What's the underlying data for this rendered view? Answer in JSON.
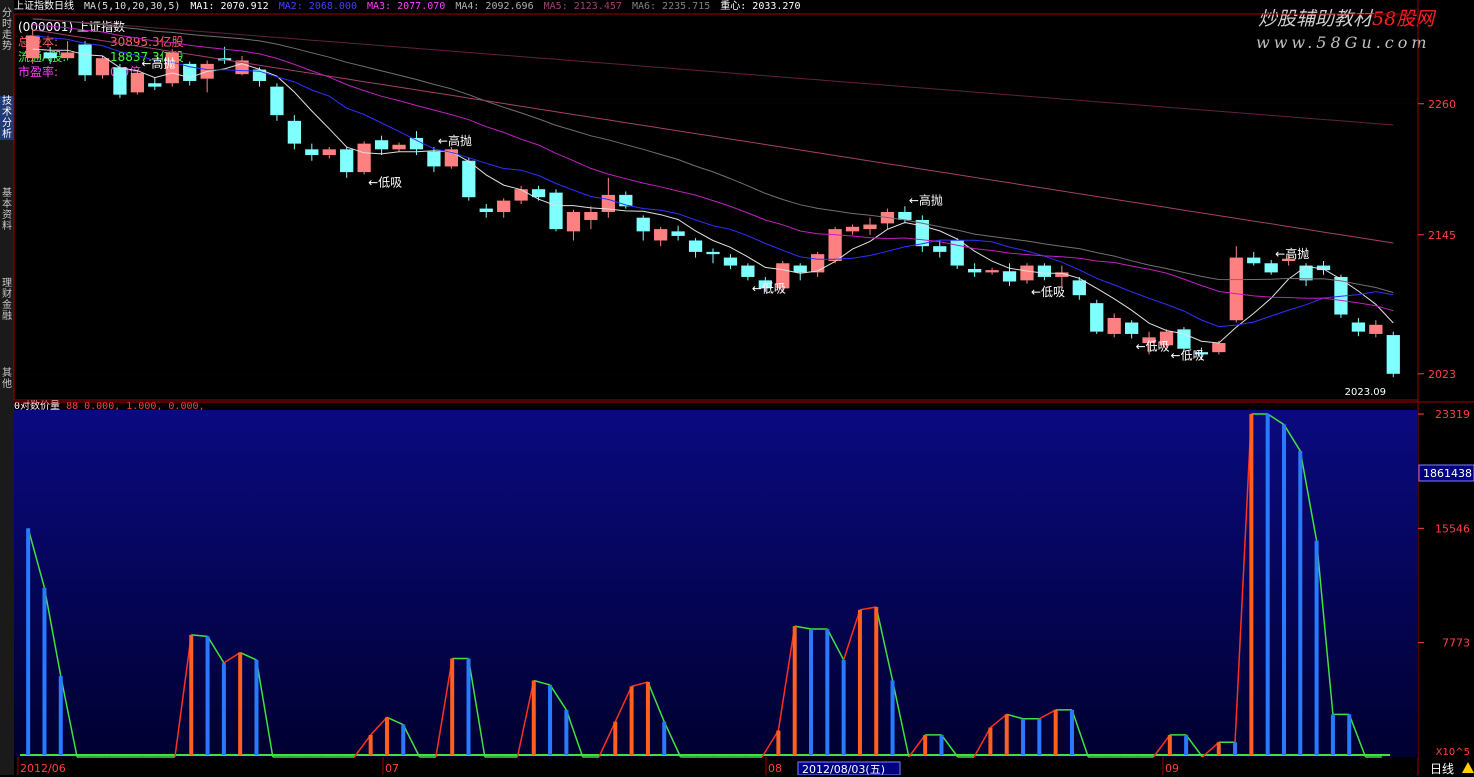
{
  "sidebar": {
    "tabs": [
      {
        "label": "分时走势",
        "active": false
      },
      {
        "label": "技术分析",
        "active": true
      },
      {
        "label": "基本资料",
        "active": false
      },
      {
        "label": "理财金融",
        "active": false
      },
      {
        "label": "其他",
        "active": false
      }
    ]
  },
  "header": {
    "title": "上证指数日线",
    "ma_params": "MA(5,10,20,30,5)",
    "ma1": "MA1: 2070.912",
    "ma2": "MA2: 2068.000",
    "ma3": "MA3: 2077.070",
    "ma4": "MA4: 2092.696",
    "ma5": "MA5: 2123.457",
    "ma6": "MA6: 2235.715",
    "center": "重心: 2033.270"
  },
  "stock_info": {
    "code_name": "(000001) 上证指数",
    "total_shares_label": "总股本:",
    "total_shares_value": "30895.3亿股",
    "float_shares_label": "流通A股:",
    "float_shares_value": "18837.3亿股",
    "pe_label": "市盈率:",
    "pe_value": "0.0倍"
  },
  "watermark": {
    "line1": "炒股辅助教材",
    "line1_red": "58股网",
    "line2": "www.58Gu.com"
  },
  "price_axis": {
    "labels": [
      "2260",
      "2145",
      "2023"
    ],
    "current": "2023.09"
  },
  "indicator": {
    "title": "0对数价量",
    "params": "88 0.000, 1.000, 0.000,",
    "axis_labels": [
      "23319",
      "15546",
      "7773",
      "X10^5"
    ],
    "current": "1861438"
  },
  "time_axis": {
    "labels": [
      "2012/06",
      "07",
      "08",
      "09"
    ],
    "cursor": "2012/08/03(五)"
  },
  "signals": {
    "high": "←高抛",
    "low": "←低吸"
  },
  "status": {
    "period": "日线"
  },
  "colors": {
    "up": "#ff8080",
    "down": "#80ffff",
    "ma_white": "#e0e0e0",
    "ma_blue": "#3030ff",
    "ma_magenta": "#c020c0",
    "ma_pink": "#a04070",
    "ind_bg_top": "#0a0a80",
    "ind_bg_bottom": "#000030",
    "bar_blue": "#2a7aff",
    "bar_orange": "#ff6020",
    "line_green": "#40e040"
  },
  "chart_data": [
    {
      "type": "candlestick",
      "title": "上证指数日线",
      "ylim": [
        2000,
        2330
      ],
      "candles": [
        {
          "o": 2300,
          "c": 2320,
          "h": 2325,
          "l": 2295
        },
        {
          "o": 2305,
          "c": 2300,
          "h": 2310,
          "l": 2295
        },
        {
          "o": 2300,
          "c": 2305,
          "h": 2315,
          "l": 2298
        },
        {
          "o": 2312,
          "c": 2285,
          "h": 2315,
          "l": 2280
        },
        {
          "o": 2285,
          "c": 2300,
          "h": 2302,
          "l": 2282
        },
        {
          "o": 2292,
          "c": 2268,
          "h": 2295,
          "l": 2265
        },
        {
          "o": 2270,
          "c": 2287,
          "h": 2290,
          "l": 2268
        },
        {
          "o": 2278,
          "c": 2275,
          "h": 2283,
          "l": 2272
        },
        {
          "o": 2278,
          "c": 2305,
          "h": 2308,
          "l": 2275
        },
        {
          "o": 2295,
          "c": 2280,
          "h": 2297,
          "l": 2276
        },
        {
          "o": 2282,
          "c": 2295,
          "h": 2298,
          "l": 2270
        },
        {
          "o": 2300,
          "c": 2298,
          "h": 2310,
          "l": 2295
        },
        {
          "o": 2286,
          "c": 2298,
          "h": 2302,
          "l": 2285
        },
        {
          "o": 2290,
          "c": 2280,
          "h": 2292,
          "l": 2275
        },
        {
          "o": 2275,
          "c": 2250,
          "h": 2278,
          "l": 2245
        },
        {
          "o": 2245,
          "c": 2225,
          "h": 2250,
          "l": 2220
        },
        {
          "o": 2220,
          "c": 2215,
          "h": 2225,
          "l": 2210
        },
        {
          "o": 2215,
          "c": 2220,
          "h": 2222,
          "l": 2212
        },
        {
          "o": 2220,
          "c": 2200,
          "h": 2222,
          "l": 2195
        },
        {
          "o": 2200,
          "c": 2225,
          "h": 2227,
          "l": 2198
        },
        {
          "o": 2228,
          "c": 2220,
          "h": 2232,
          "l": 2215
        },
        {
          "o": 2220,
          "c": 2224,
          "h": 2226,
          "l": 2218
        },
        {
          "o": 2230,
          "c": 2220,
          "h": 2236,
          "l": 2215
        },
        {
          "o": 2218,
          "c": 2205,
          "h": 2222,
          "l": 2200
        },
        {
          "o": 2205,
          "c": 2220,
          "h": 2222,
          "l": 2203
        },
        {
          "o": 2210,
          "c": 2178,
          "h": 2213,
          "l": 2175
        },
        {
          "o": 2168,
          "c": 2165,
          "h": 2172,
          "l": 2160
        },
        {
          "o": 2165,
          "c": 2175,
          "h": 2177,
          "l": 2160
        },
        {
          "o": 2175,
          "c": 2185,
          "h": 2188,
          "l": 2172
        },
        {
          "o": 2185,
          "c": 2178,
          "h": 2188,
          "l": 2175
        },
        {
          "o": 2182,
          "c": 2150,
          "h": 2185,
          "l": 2148
        },
        {
          "o": 2148,
          "c": 2165,
          "h": 2167,
          "l": 2140
        },
        {
          "o": 2158,
          "c": 2165,
          "h": 2170,
          "l": 2150
        },
        {
          "o": 2165,
          "c": 2180,
          "h": 2195,
          "l": 2160
        },
        {
          "o": 2180,
          "c": 2170,
          "h": 2183,
          "l": 2168
        },
        {
          "o": 2160,
          "c": 2148,
          "h": 2162,
          "l": 2140
        },
        {
          "o": 2140,
          "c": 2150,
          "h": 2152,
          "l": 2135
        },
        {
          "o": 2148,
          "c": 2144,
          "h": 2153,
          "l": 2140
        },
        {
          "o": 2140,
          "c": 2130,
          "h": 2142,
          "l": 2125
        },
        {
          "o": 2130,
          "c": 2128,
          "h": 2133,
          "l": 2120
        },
        {
          "o": 2125,
          "c": 2118,
          "h": 2128,
          "l": 2115
        },
        {
          "o": 2118,
          "c": 2108,
          "h": 2120,
          "l": 2105
        },
        {
          "o": 2105,
          "c": 2098,
          "h": 2108,
          "l": 2095
        },
        {
          "o": 2098,
          "c": 2120,
          "h": 2122,
          "l": 2095
        },
        {
          "o": 2118,
          "c": 2112,
          "h": 2120,
          "l": 2105
        },
        {
          "o": 2112,
          "c": 2128,
          "h": 2130,
          "l": 2108
        },
        {
          "o": 2122,
          "c": 2150,
          "h": 2152,
          "l": 2120
        },
        {
          "o": 2148,
          "c": 2152,
          "h": 2154,
          "l": 2145
        },
        {
          "o": 2150,
          "c": 2154,
          "h": 2160,
          "l": 2145
        },
        {
          "o": 2155,
          "c": 2165,
          "h": 2168,
          "l": 2150
        },
        {
          "o": 2165,
          "c": 2158,
          "h": 2170,
          "l": 2155
        },
        {
          "o": 2158,
          "c": 2135,
          "h": 2162,
          "l": 2130
        },
        {
          "o": 2135,
          "c": 2130,
          "h": 2140,
          "l": 2125
        },
        {
          "o": 2140,
          "c": 2118,
          "h": 2142,
          "l": 2115
        },
        {
          "o": 2115,
          "c": 2112,
          "h": 2120,
          "l": 2108
        },
        {
          "o": 2112,
          "c": 2114,
          "h": 2116,
          "l": 2110
        },
        {
          "o": 2113,
          "c": 2104,
          "h": 2120,
          "l": 2100
        },
        {
          "o": 2105,
          "c": 2118,
          "h": 2120,
          "l": 2102
        },
        {
          "o": 2118,
          "c": 2108,
          "h": 2120,
          "l": 2105
        },
        {
          "o": 2108,
          "c": 2112,
          "h": 2118,
          "l": 2100
        },
        {
          "o": 2105,
          "c": 2092,
          "h": 2108,
          "l": 2088
        },
        {
          "o": 2085,
          "c": 2060,
          "h": 2088,
          "l": 2058
        },
        {
          "o": 2058,
          "c": 2072,
          "h": 2076,
          "l": 2055
        },
        {
          "o": 2068,
          "c": 2058,
          "h": 2070,
          "l": 2054
        },
        {
          "o": 2050,
          "c": 2055,
          "h": 2060,
          "l": 2040
        },
        {
          "o": 2048,
          "c": 2060,
          "h": 2062,
          "l": 2046
        },
        {
          "o": 2062,
          "c": 2045,
          "h": 2064,
          "l": 2042
        },
        {
          "o": 2042,
          "c": 2040,
          "h": 2046,
          "l": 2035
        },
        {
          "o": 2042,
          "c": 2050,
          "h": 2052,
          "l": 2040
        },
        {
          "o": 2070,
          "c": 2125,
          "h": 2135,
          "l": 2068
        },
        {
          "o": 2125,
          "c": 2120,
          "h": 2130,
          "l": 2118
        },
        {
          "o": 2120,
          "c": 2112,
          "h": 2123,
          "l": 2110
        },
        {
          "o": 2122,
          "c": 2124,
          "h": 2128,
          "l": 2118
        },
        {
          "o": 2118,
          "c": 2105,
          "h": 2120,
          "l": 2100
        },
        {
          "o": 2118,
          "c": 2114,
          "h": 2122,
          "l": 2110
        },
        {
          "o": 2108,
          "c": 2075,
          "h": 2110,
          "l": 2072
        },
        {
          "o": 2068,
          "c": 2060,
          "h": 2072,
          "l": 2056
        },
        {
          "o": 2058,
          "c": 2066,
          "h": 2070,
          "l": 2055
        },
        {
          "o": 2057,
          "c": 2023,
          "h": 2060,
          "l": 2020
        }
      ],
      "signal_marks": [
        {
          "index": 6,
          "label": "←高抛"
        },
        {
          "index": 19,
          "label": "←低吸"
        },
        {
          "index": 23,
          "label": "←高抛"
        },
        {
          "index": 41,
          "label": "←低吸"
        },
        {
          "index": 50,
          "label": "←高抛"
        },
        {
          "index": 57,
          "label": "←低吸"
        },
        {
          "index": 63,
          "label": "←低吸"
        },
        {
          "index": 65,
          "label": "←低吸"
        },
        {
          "index": 71,
          "label": "←高抛"
        }
      ]
    },
    {
      "type": "bar",
      "title": "0对数价量",
      "ylim": [
        0,
        23319
      ],
      "values": [
        15546,
        11500,
        5500,
        0,
        0,
        0,
        0,
        0,
        0,
        0,
        8300,
        8200,
        6400,
        7100,
        6600,
        0,
        0,
        0,
        0,
        0,
        0,
        1500,
        2700,
        2200,
        0,
        0,
        6700,
        6700,
        0,
        0,
        0,
        5200,
        4900,
        3200,
        0,
        0,
        2400,
        4800,
        5100,
        2400,
        0,
        0,
        0,
        0,
        0,
        0,
        1800,
        8900,
        8700,
        8700,
        6600,
        10000,
        10200,
        5200,
        0,
        1500,
        1500,
        0,
        0,
        2000,
        2900,
        2600,
        2600,
        3200,
        3200,
        0,
        0,
        0,
        0,
        0,
        1500,
        1500,
        0,
        1000,
        1000,
        23319,
        23319,
        22600,
        20800,
        14700,
        2900,
        2900,
        0,
        0
      ],
      "series_colors": [
        "blue",
        "orange"
      ]
    }
  ]
}
